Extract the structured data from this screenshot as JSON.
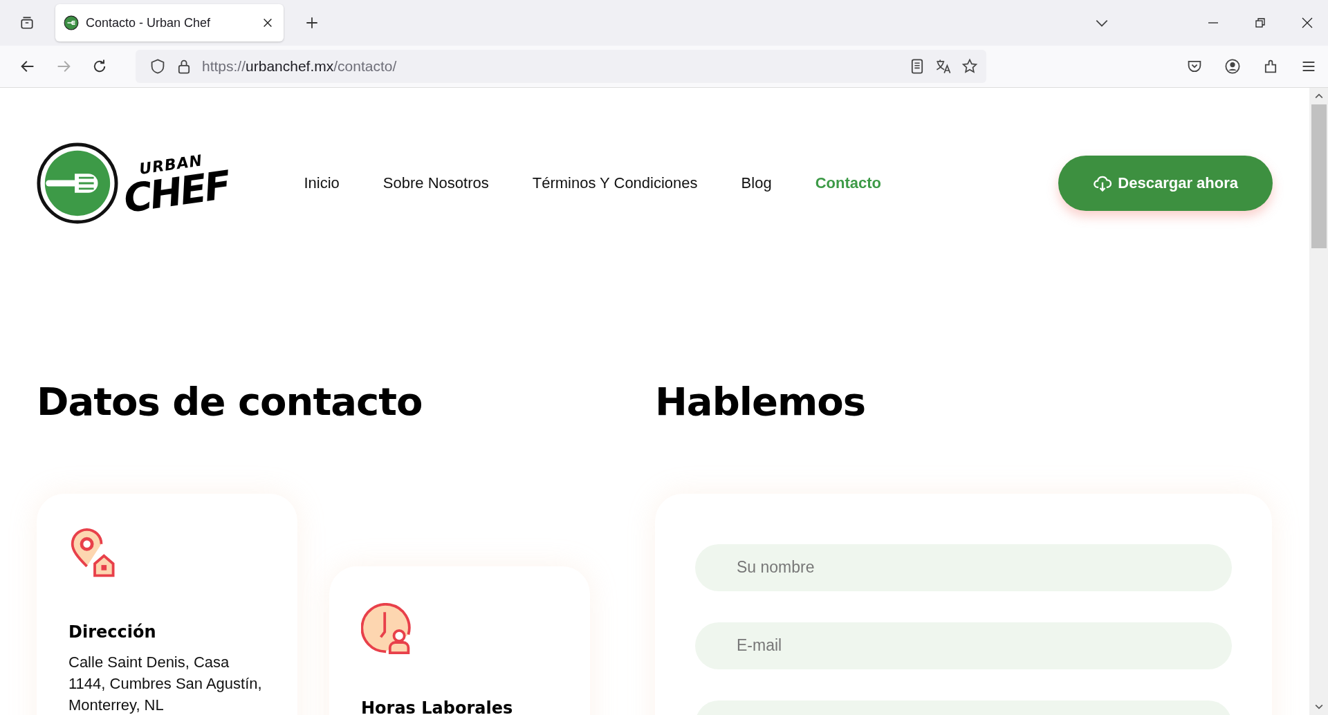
{
  "browser": {
    "tab_title": "Contacto - Urban Chef",
    "url_scheme": "https://",
    "url_host": "urbanchef.mx",
    "url_path": "/contacto/"
  },
  "logo": {
    "small_word": "URBAN",
    "big_word": "CHEF"
  },
  "nav": [
    {
      "label": "Inicio",
      "selected": false
    },
    {
      "label": "Sobre Nosotros",
      "selected": false
    },
    {
      "label": "Términos Y Condiciones",
      "selected": false
    },
    {
      "label": "Blog",
      "selected": false
    },
    {
      "label": "Contacto",
      "selected": true
    }
  ],
  "download_button": "Descargar ahora",
  "contact_heading": "Datos de contacto",
  "form_heading": "Hablemos",
  "cards": [
    {
      "kind": "address",
      "title": "Dirección",
      "text": "Calle Saint Denis, Casa 1144, Cumbres San Agustín, Monterrey, NL"
    },
    {
      "kind": "hours",
      "title": "Horas Laborales"
    }
  ],
  "form_fields": [
    {
      "kind": "text",
      "placeholder": "Su nombre"
    },
    {
      "kind": "text",
      "placeholder": "E-mail"
    },
    {
      "kind": "text"
    }
  ]
}
